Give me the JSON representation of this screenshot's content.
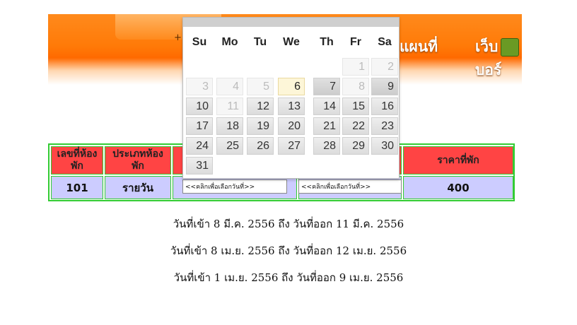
{
  "header": {
    "plus": "++",
    "nav_items": [
      "แผนที่",
      "เว็บบอร์"
    ]
  },
  "table": {
    "headers": [
      "เลขที่ห้อง\nพัก",
      "ประเภทห้อง\nพัก",
      "ราคาที่พัก"
    ],
    "row": {
      "room_no": "101",
      "room_type": "รายวัน",
      "price": "400"
    },
    "checkin_placeholder": "<<คลิกเพื่อเลือกวันที่>>",
    "checkout_placeholder": "<<คลิกเพื่อเลือกวันที่>>"
  },
  "bookings": [
    "วันที่เข้า 8 มี.ค. 2556 ถึง วันที่ออก 11 มี.ค. 2556",
    "วันที่เข้า 8 เม.ย. 2556 ถึง วันที่ออก 12 เม.ย. 2556",
    "วันที่เข้า 1 เม.ย. 2556 ถึง วันที่ออก 9 เม.ย. 2556"
  ],
  "calendar": {
    "weekdays": [
      "Su",
      "Mo",
      "Tu",
      "We",
      "Th",
      "Fr",
      "Sa"
    ],
    "days": [
      {
        "label": "1",
        "state": "muted"
      },
      {
        "label": "2",
        "state": "muted"
      },
      {
        "label": "3",
        "state": "muted"
      },
      {
        "label": "4",
        "state": "muted"
      },
      {
        "label": "5",
        "state": "muted"
      },
      {
        "label": "6",
        "state": "today"
      },
      {
        "label": "7",
        "state": "dark"
      },
      {
        "label": "8",
        "state": "muted"
      },
      {
        "label": "9",
        "state": "dark"
      },
      {
        "label": "10",
        "state": "normal"
      },
      {
        "label": "11",
        "state": "muted"
      },
      {
        "label": "12",
        "state": "normal"
      },
      {
        "label": "13",
        "state": "normal"
      },
      {
        "label": "14",
        "state": "normal"
      },
      {
        "label": "15",
        "state": "normal"
      },
      {
        "label": "16",
        "state": "normal"
      },
      {
        "label": "17",
        "state": "normal"
      },
      {
        "label": "18",
        "state": "normal"
      },
      {
        "label": "19",
        "state": "normal"
      },
      {
        "label": "20",
        "state": "normal"
      },
      {
        "label": "21",
        "state": "normal"
      },
      {
        "label": "22",
        "state": "normal"
      },
      {
        "label": "23",
        "state": "normal"
      },
      {
        "label": "24",
        "state": "normal"
      },
      {
        "label": "25",
        "state": "normal"
      },
      {
        "label": "26",
        "state": "normal"
      },
      {
        "label": "27",
        "state": "normal"
      },
      {
        "label": "28",
        "state": "normal"
      },
      {
        "label": "29",
        "state": "normal"
      },
      {
        "label": "30",
        "state": "normal"
      },
      {
        "label": "31",
        "state": "normal"
      }
    ],
    "first_day_column": 5
  }
}
